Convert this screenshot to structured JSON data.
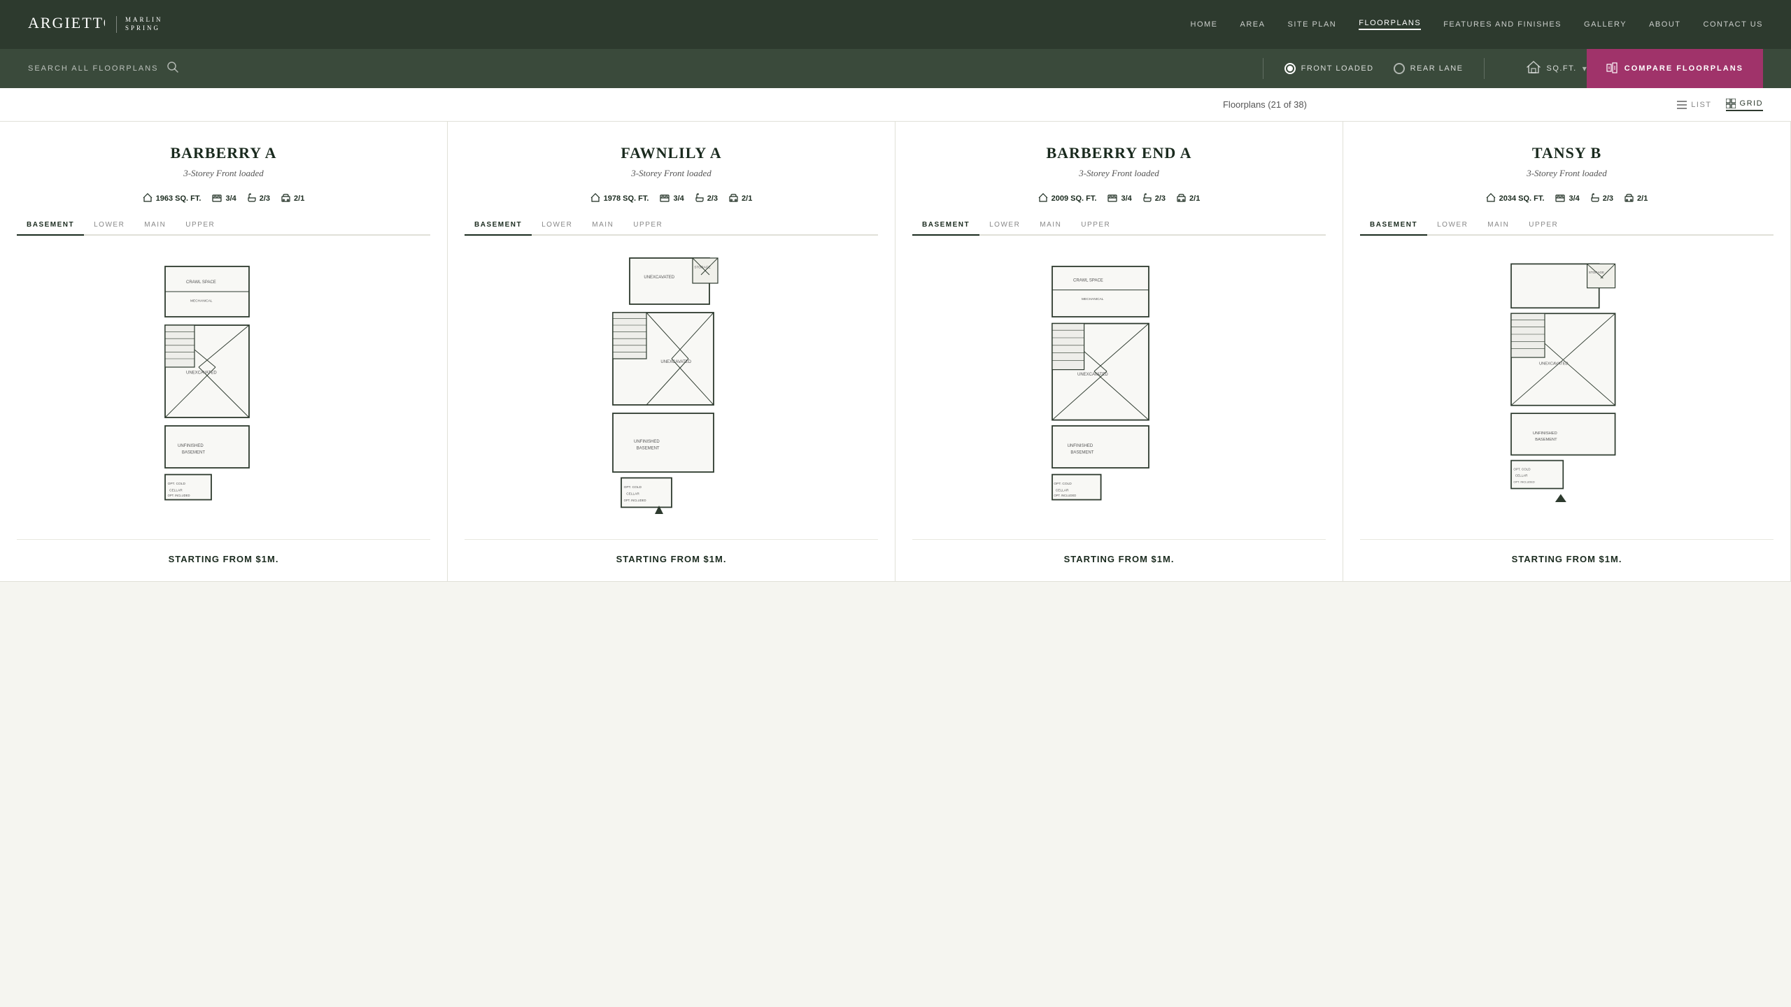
{
  "header": {
    "logo_name": "ARGIETTO",
    "logo_sub_line1": "MARLIN",
    "logo_sub_line2": "SPRING",
    "nav_items": [
      {
        "label": "HOME",
        "active": false
      },
      {
        "label": "AREA",
        "active": false
      },
      {
        "label": "SITE PLAN",
        "active": false
      },
      {
        "label": "FLOORPLANS",
        "active": true
      },
      {
        "label": "FEATURES AND FINISHES",
        "active": false
      },
      {
        "label": "GALLERY",
        "active": false
      },
      {
        "label": "ABOUT",
        "active": false
      },
      {
        "label": "CONTACT US",
        "active": false
      }
    ]
  },
  "search_bar": {
    "search_label": "SEARCH ALL FLOORPLANS",
    "radio_options": [
      {
        "label": "FRONT LOADED",
        "selected": true
      },
      {
        "label": "REAR LANE",
        "selected": false
      }
    ],
    "sqft_label": "SQ.FT.",
    "compare_label": "COMPARE FLOORPLANS"
  },
  "subtitle": {
    "text": "Floorplans (21 of 38)",
    "list_label": "LIST",
    "grid_label": "GRID"
  },
  "cards": [
    {
      "title": "BARBERRY A",
      "subtitle": "3-Storey Front loaded",
      "sqft": "1963 SQ. FT.",
      "beds": "3/4",
      "baths": "2/3",
      "parking": "2/1",
      "tabs": [
        "BASEMENT",
        "LOWER",
        "MAIN",
        "UPPER"
      ],
      "active_tab": "BASEMENT",
      "price": "STARTING FROM $1M."
    },
    {
      "title": "FAWNLILY A",
      "subtitle": "3-Storey Front loaded",
      "sqft": "1978 SQ. FT.",
      "beds": "3/4",
      "baths": "2/3",
      "parking": "2/1",
      "tabs": [
        "BASEMENT",
        "LOWER",
        "MAIN",
        "UPPER"
      ],
      "active_tab": "BASEMENT",
      "price": "STARTING FROM $1M."
    },
    {
      "title": "BARBERRY END A",
      "subtitle": "3-Storey Front loaded",
      "sqft": "2009 SQ. FT.",
      "beds": "3/4",
      "baths": "2/3",
      "parking": "2/1",
      "tabs": [
        "BASEMENT",
        "LOWER",
        "MAIN",
        "UPPER"
      ],
      "active_tab": "BASEMENT",
      "price": "STARTING FROM $1M."
    },
    {
      "title": "TANSY B",
      "subtitle": "3-Storey Front loaded",
      "sqft": "2034 SQ. FT.",
      "beds": "3/4",
      "baths": "2/3",
      "parking": "2/1",
      "tabs": [
        "BASEMENT",
        "LOWER",
        "MAIN",
        "UPPER"
      ],
      "active_tab": "BASEMENT",
      "price": "STARTING FROM $1M."
    }
  ],
  "colors": {
    "header_bg": "#2d3a2e",
    "search_bg": "#3a4a3b",
    "compare_bg": "#a0336a",
    "accent": "#2d3a2e"
  }
}
